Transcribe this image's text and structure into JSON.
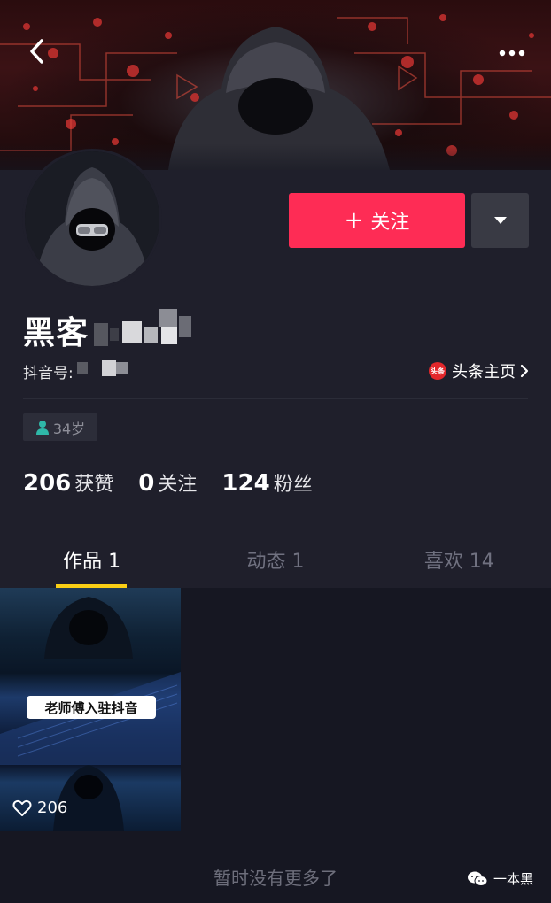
{
  "header": {
    "back_icon": "chevron-left-icon",
    "more_icon": "more-dots-icon"
  },
  "profile": {
    "name": "黑客",
    "douyin_id_label": "抖音号:",
    "toutiao_logo_text": "头条",
    "toutiao_link": "头条主页",
    "age": "34岁",
    "follow_button": "关注",
    "follow_plus": "+"
  },
  "stats": [
    {
      "value": "206",
      "label": "获赞"
    },
    {
      "value": "0",
      "label": "关注"
    },
    {
      "value": "124",
      "label": "粉丝"
    }
  ],
  "tabs": [
    {
      "label": "作品 1",
      "active": true
    },
    {
      "label": "动态 1",
      "active": false
    },
    {
      "label": "喜欢 14",
      "active": false
    }
  ],
  "video": {
    "caption": "老师傅入驻抖音",
    "likes": "206"
  },
  "footer": {
    "no_more": "暂时没有更多了",
    "watermark": "一本黑"
  },
  "colors": {
    "follow_button": "#fe2c55",
    "tab_underline": "#face15",
    "background": "#161722",
    "panel": "#1f1f2b"
  }
}
